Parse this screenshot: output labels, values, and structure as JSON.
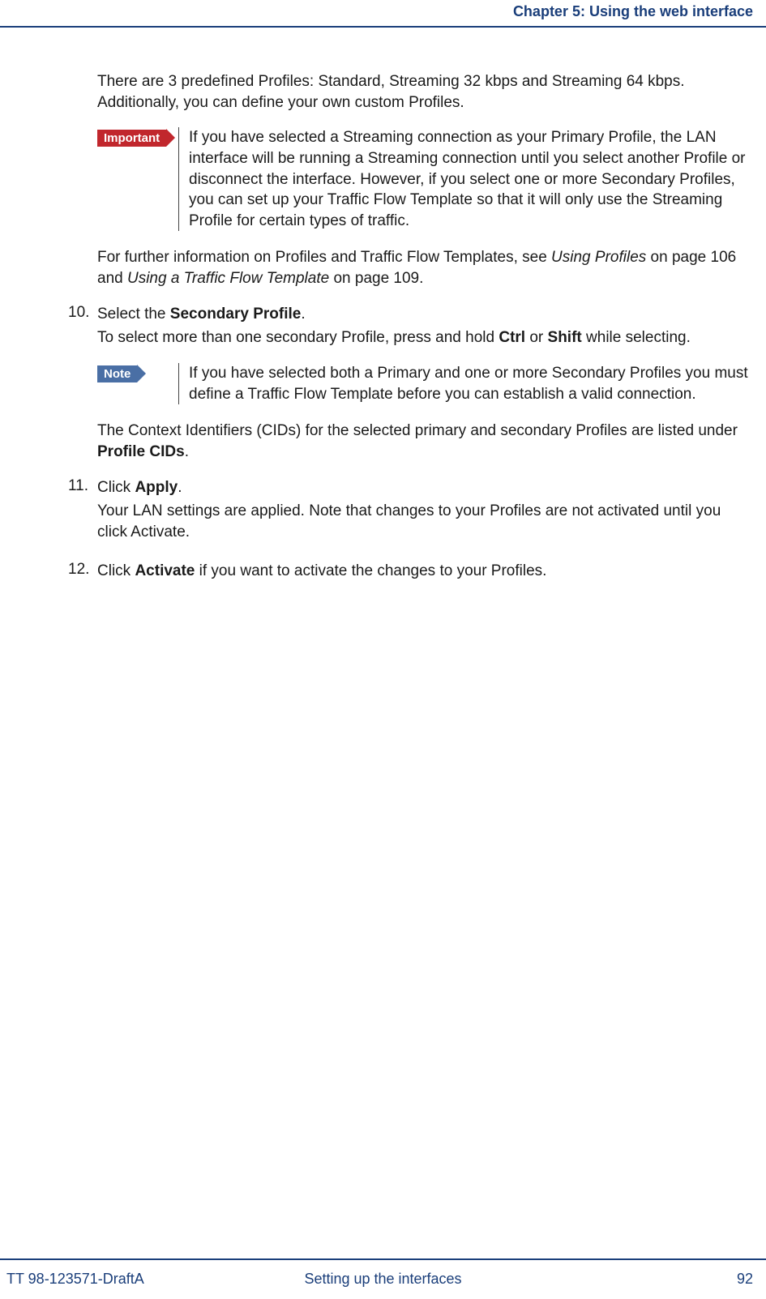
{
  "header": {
    "chapter": "Chapter 5: Using the web interface"
  },
  "intro": {
    "p1_a": "There are 3 predefined Profiles: Standard, Streaming 32 kbps and Streaming 64 kbps.",
    "p1_b": "Additionally, you can define your own custom Profiles."
  },
  "callout1": {
    "tag": "Important",
    "text": "If you have selected a Streaming connection as your Primary Profile, the LAN interface will be running a Streaming connection until you select another Profile or disconnect the interface. However, if you select one or more Secondary Profiles, you can set up your Traffic Flow Template so that it will only use the Streaming Profile for certain types of traffic."
  },
  "after_callout1": {
    "a": "For further information on Profiles and Traffic Flow Templates, see ",
    "i1": "Using Profiles",
    "b": " on page 106 and ",
    "i2": "Using a Traffic Flow Template",
    "c": " on page 109."
  },
  "step10": {
    "num": "10.",
    "line1_a": "Select the ",
    "line1_b": "Secondary Profile",
    "line1_c": ".",
    "line2_a": "To select more than one secondary Profile, press and hold ",
    "line2_b": "Ctrl",
    "line2_c": " or ",
    "line2_d": "Shift",
    "line2_e": " while selecting.",
    "after_a": "The Context Identifiers (CIDs) for the selected primary and secondary Profiles are listed under ",
    "after_b": "Profile CIDs",
    "after_c": "."
  },
  "callout2": {
    "tag": "Note",
    "text": "If you have selected both a Primary and one or more Secondary Profiles you must define a Traffic Flow Template before you can establish a valid connection."
  },
  "step11": {
    "num": "11.",
    "line1_a": "Click ",
    "line1_b": "Apply",
    "line1_c": ".",
    "line2": "Your LAN settings are applied. Note that changes to your Profiles are not activated until you click Activate."
  },
  "step12": {
    "num": "12.",
    "line1_a": "Click ",
    "line1_b": "Activate",
    "line1_c": " if you want to activate the changes to your Profiles."
  },
  "footer": {
    "left": "TT 98-123571-DraftA",
    "center": "Setting up the interfaces",
    "right": "92"
  }
}
